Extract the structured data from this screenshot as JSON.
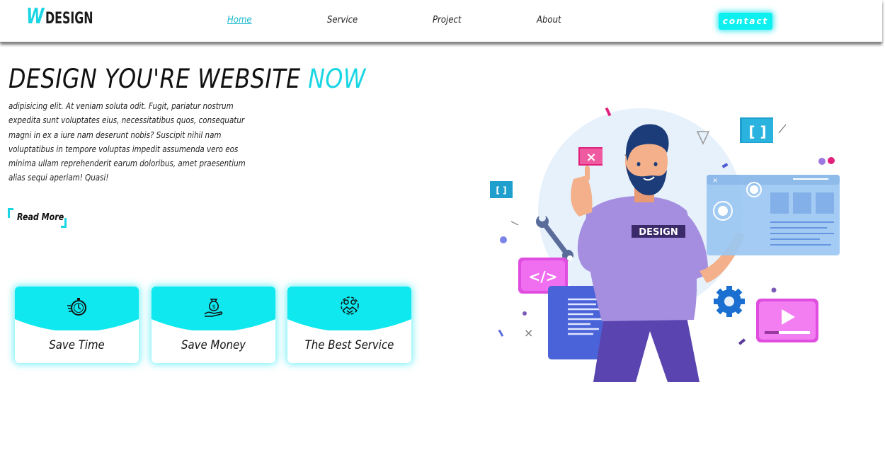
{
  "nav": {
    "logo_w": "W",
    "logo_rest": "DESIGN",
    "links": [
      "Home",
      "Service",
      "Project",
      "About"
    ],
    "contact_label": "contact"
  },
  "hero": {
    "title_main": "DESIGN YOU'RE WEBSITE ",
    "title_accent": "NOW",
    "paragraph": "adipisicing elit. At veniam soluta odit. Fugit, pariatur nostrum expedita sunt voluptates eius, necessitatibus quos, consequatur magni in ex a iure nam deserunt nobis? Suscipit nihil nam voluptatibus in tempore voluptas impedit assumenda vero eos minima ullam reprehenderit earum doloribus, amet praesentium alias sequi aperiam! Quasi!",
    "read_more": "Read More"
  },
  "features": [
    {
      "label": "Save Time",
      "icon": "stopwatch-icon"
    },
    {
      "label": "Save Money",
      "icon": "money-bag-hand-icon"
    },
    {
      "label": "The Best Service",
      "icon": "service-handshake-icon"
    }
  ],
  "illustration": {
    "shirt_text": "DESIGN",
    "code_symbol": "</>",
    "bracket_symbol": "[ ]"
  },
  "colors": {
    "accent": "#19d6e4",
    "card_top": "#0ee8ee",
    "shirt": "#a58ee0",
    "screen": "#9cc7f3",
    "magenta": "#e04ee0"
  }
}
